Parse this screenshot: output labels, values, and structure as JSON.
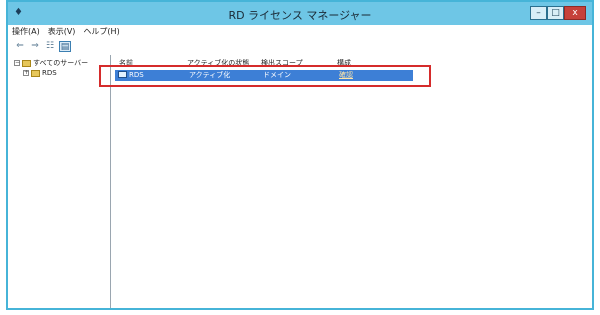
{
  "window": {
    "title": "RD ライセンス マネージャー",
    "controls": {
      "minimize": "–",
      "maximize": "□",
      "close": "x"
    }
  },
  "menu": [
    "操作(A)",
    "表示(V)",
    "ヘルプ(H)"
  ],
  "toolbar": [
    "back-arrow",
    "forward-arrow",
    "list-view",
    "detail-view"
  ],
  "tree": {
    "root": "すべてのサーバー",
    "child": "RDS"
  },
  "table": {
    "columns": [
      "名前",
      "アクティブ化の状態",
      "検出スコープ",
      "構成"
    ],
    "rows": [
      {
        "name": "RDS",
        "activation": "アクティブ化",
        "scope": "ドメイン",
        "config": "確認"
      }
    ]
  },
  "colors": {
    "titlebar": "#6ec6e6",
    "selection": "#3d7fd6",
    "highlight": "#d52b2b"
  }
}
